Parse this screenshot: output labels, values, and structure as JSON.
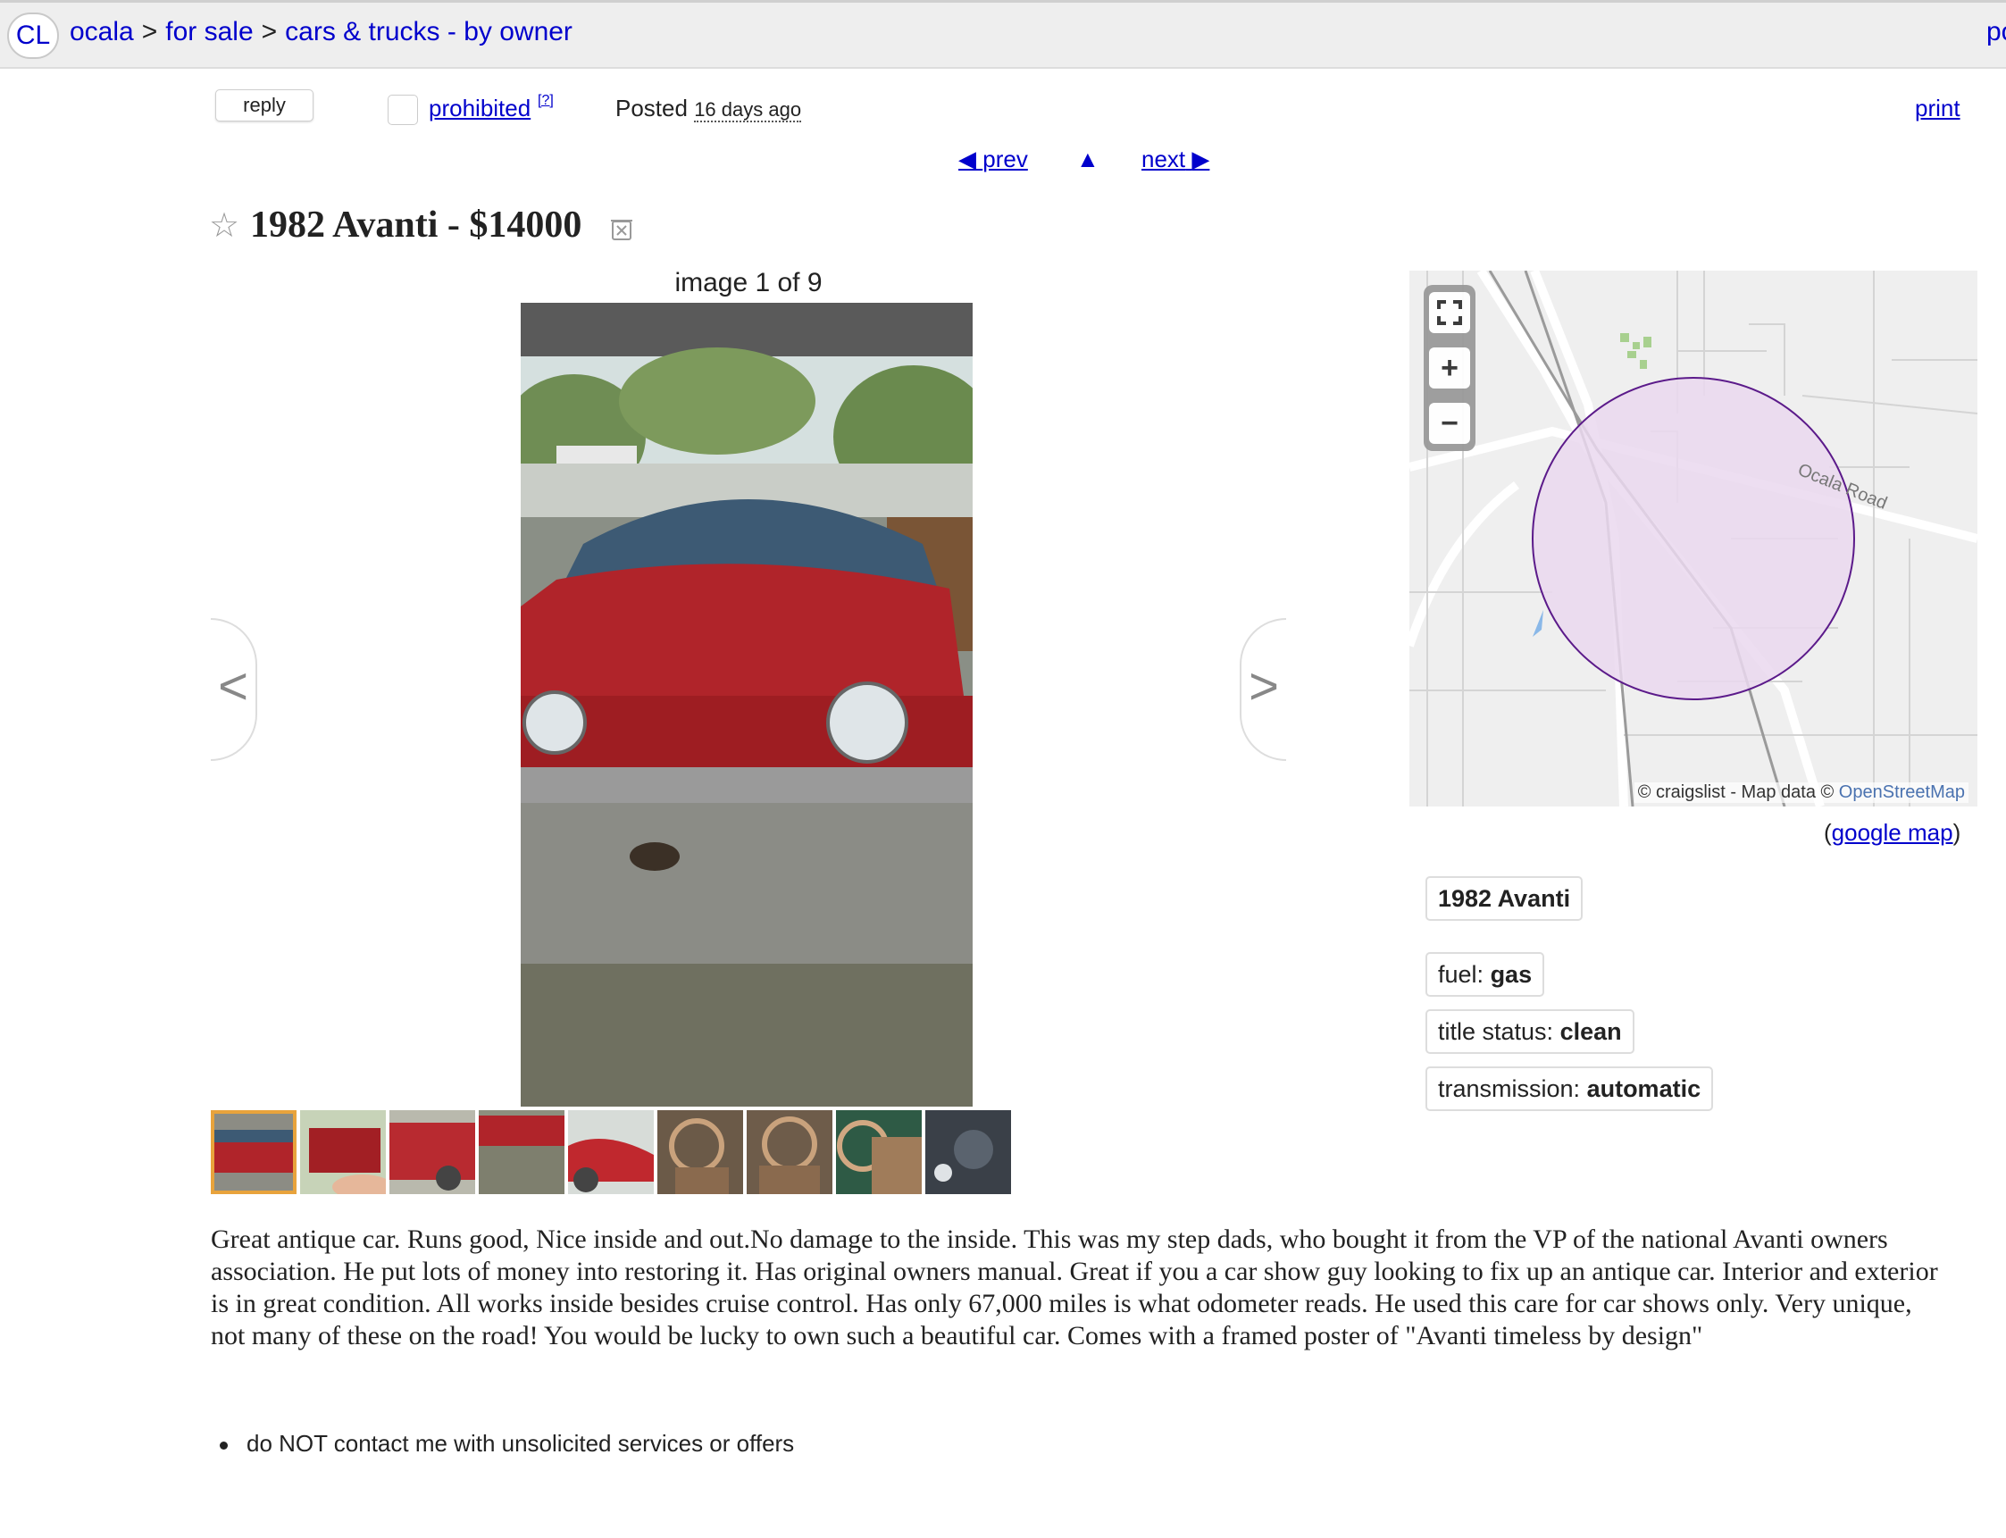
{
  "header": {
    "logo": "CL",
    "breadcrumbs": [
      "ocala",
      "for sale",
      "cars & trucks - by owner"
    ],
    "separator": ">",
    "right_clipped": "po"
  },
  "actions": {
    "reply": "reply",
    "prohibited": "prohibited",
    "help": "[?]",
    "posted_label": "Posted",
    "posted_ago": "16 days ago",
    "print": "print"
  },
  "nav": {
    "prev": "prev",
    "next": "next",
    "prev_icon": "◀",
    "up_icon": "▲",
    "next_icon": "▶"
  },
  "listing": {
    "title": "1982 Avanti - $14000",
    "image_counter": "image 1 of 9",
    "prev_image": "<",
    "next_image": ">",
    "thumbnail_count": 9,
    "active_thumbnail": 1
  },
  "map": {
    "attribution_prefix": "© craigslist - Map data ©",
    "attribution_link": "OpenStreetMap",
    "road_label": "Ocala Road",
    "zoom_in": "+",
    "zoom_out": "−",
    "google_map_open": "(",
    "google_map": "google map",
    "google_map_close": ")",
    "circle_color": "#ead8ee",
    "circle_stroke": "#5b1a8a"
  },
  "attributes": {
    "heading": "1982 Avanti",
    "fuel_label": "fuel:",
    "fuel_value": "gas",
    "title_label": "title status:",
    "title_value": "clean",
    "transmission_label": "transmission:",
    "transmission_value": "automatic"
  },
  "body": "Great antique car. Runs good, Nice inside and out.No damage to the inside. This was my step dads, who bought it from the VP of the national Avanti owners association. He put lots of money into restoring it. Has original owners manual. Great if you a car show guy looking to fix up an antique car. Interior and exterior is in great condition. All works inside besides cruise control. Has only 67,000 miles is what odometer reads. He used this care for car shows only. Very unique, not many of these on the road! You would be lucky to own such a beautiful car. Comes with a framed poster of \"Avanti timeless by design\"",
  "notices": [
    "do NOT contact me with unsolicited services or offers"
  ],
  "colors": {
    "link": "#0000cc",
    "active_thumb_border": "#e8a33c",
    "car_red": "#b0242a"
  }
}
